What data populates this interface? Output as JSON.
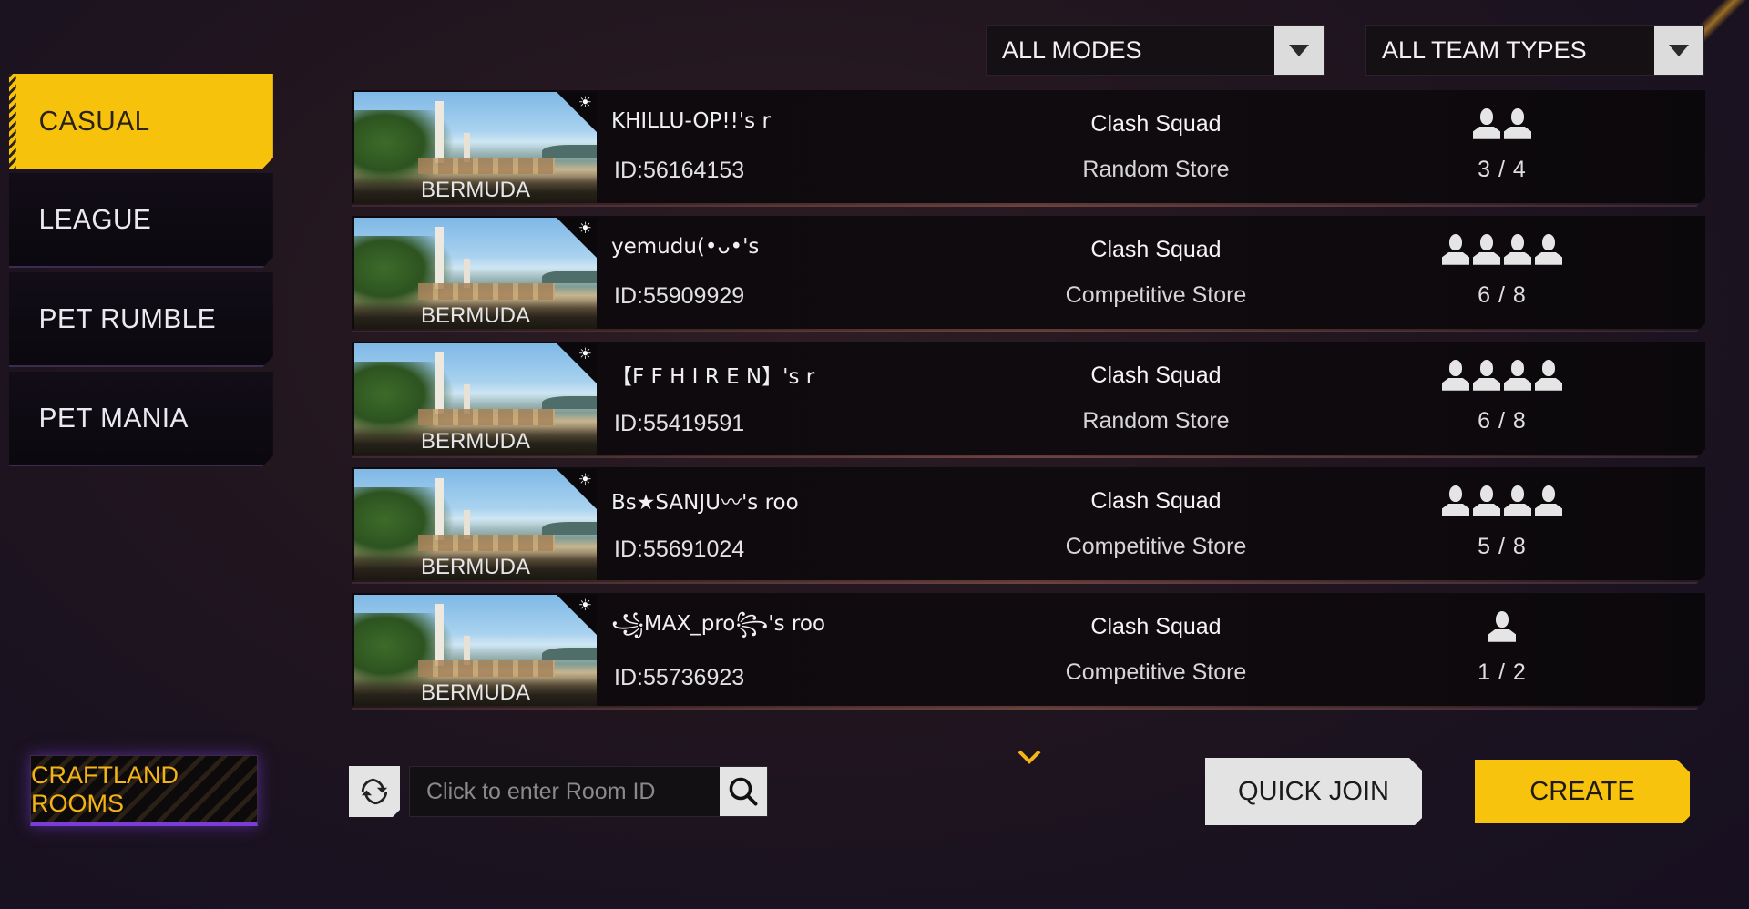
{
  "filters": {
    "mode": {
      "selected": "ALL MODES"
    },
    "team_type": {
      "selected": "ALL TEAM TYPES"
    }
  },
  "sidebar": {
    "items": [
      {
        "label": "CASUAL",
        "active": true
      },
      {
        "label": "LEAGUE",
        "active": false
      },
      {
        "label": "PET RUMBLE",
        "active": false
      },
      {
        "label": "PET MANIA",
        "active": false
      }
    ],
    "craftland_label": "CRAFTLAND ROOMS"
  },
  "rooms": [
    {
      "map": "BERMUDA",
      "name": "KHILLU-OP!!'s r",
      "id": "ID:56164153",
      "mode": "Clash Squad",
      "store": "Random Store",
      "player_icons": 2,
      "count": "3 / 4"
    },
    {
      "map": "BERMUDA",
      "name": "yemudu(•ᴗ•'s",
      "id": "ID:55909929",
      "mode": "Clash Squad",
      "store": "Competitive Store",
      "player_icons": 4,
      "count": "6 / 8"
    },
    {
      "map": "BERMUDA",
      "name": "【F F   H I R E N】's r",
      "id": "ID:55419591",
      "mode": "Clash Squad",
      "store": "Random Store",
      "player_icons": 4,
      "count": "6 / 8"
    },
    {
      "map": "BERMUDA",
      "name": "Bs★SANJU〰's roo",
      "id": "ID:55691024",
      "mode": "Clash Squad",
      "store": "Competitive Store",
      "player_icons": 4,
      "count": "5 / 8"
    },
    {
      "map": "BERMUDA",
      "name": "꧁MAX_pro꧂'s roo",
      "id": "ID:55736923",
      "mode": "Clash Squad",
      "store": "Competitive Store",
      "player_icons": 1,
      "count": "1 / 2"
    }
  ],
  "search": {
    "placeholder": "Click to enter Room ID",
    "value": ""
  },
  "actions": {
    "quick_join": "QUICK JOIN",
    "create": "CREATE"
  },
  "icons": {
    "sun": "☀",
    "refresh": "refresh-icon",
    "search": "search-icon",
    "chevron": "chevron-down-icon",
    "player": "person-icon"
  },
  "colors": {
    "accent_yellow": "#f8c30c",
    "craftland_text": "#f4b416",
    "craftland_glow": "#7a3dd6"
  }
}
